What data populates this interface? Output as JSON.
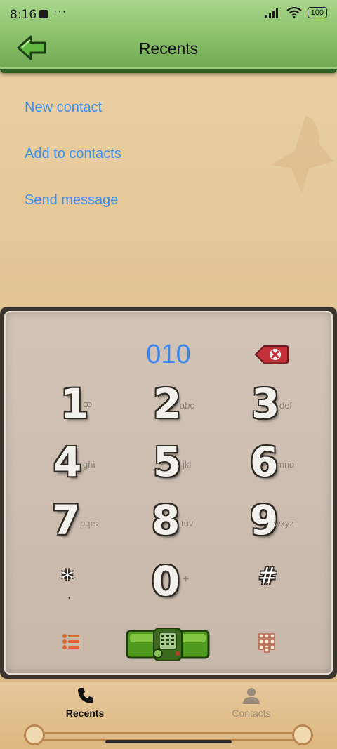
{
  "status": {
    "time": "8:16",
    "dots": "···",
    "battery": "100"
  },
  "header": {
    "title": "Recents"
  },
  "actions": {
    "new_contact": "New contact",
    "add_to_contacts": "Add to contacts",
    "send_message": "Send message"
  },
  "dialer": {
    "number": "010",
    "keys": [
      {
        "digit": "1",
        "letters": "ꝏ"
      },
      {
        "digit": "2",
        "letters": "abc"
      },
      {
        "digit": "3",
        "letters": "def"
      },
      {
        "digit": "4",
        "letters": "ghi"
      },
      {
        "digit": "5",
        "letters": "jkl"
      },
      {
        "digit": "6",
        "letters": "mno"
      },
      {
        "digit": "7",
        "letters": "pqrs"
      },
      {
        "digit": "8",
        "letters": "tuv"
      },
      {
        "digit": "9",
        "letters": "wxyz"
      },
      {
        "digit": "*",
        "letters": ","
      },
      {
        "digit": "0",
        "letters": "+"
      },
      {
        "digit": "#",
        "letters": ""
      }
    ]
  },
  "nav": {
    "recents": "Recents",
    "contacts": "Contacts"
  },
  "colors": {
    "accent": "#3d8ff0",
    "header_green": "#88c06a",
    "active_nav": "#111111",
    "inactive_nav": "#9a8a79"
  }
}
